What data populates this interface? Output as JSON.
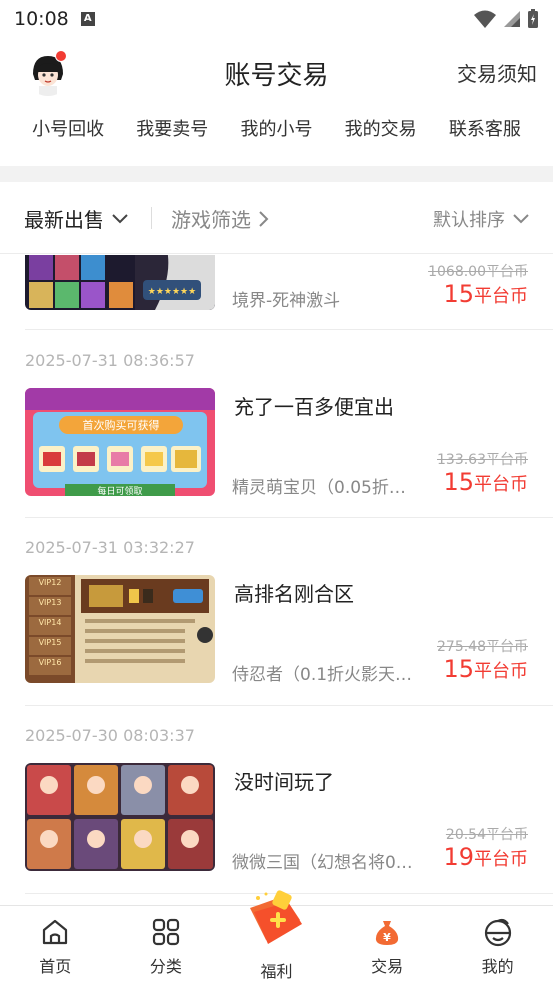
{
  "status": {
    "time": "10:08",
    "badge": "A"
  },
  "header": {
    "title": "账号交易",
    "notice": "交易须知"
  },
  "nav_links": [
    "小号回收",
    "我要卖号",
    "我的小号",
    "我的交易",
    "联系客服"
  ],
  "filters": {
    "latest": "最新出售",
    "game_filter": "游戏筛选",
    "sort": "默认排序"
  },
  "items": [
    {
      "date": "",
      "title": "",
      "game": "境界-死神激斗",
      "old_price": "1068.00平台币",
      "price": "15",
      "unit": "平台币",
      "thumb": "anime-roster"
    },
    {
      "date": "2025-07-31 08:36:57",
      "title": "充了一百多便宜出",
      "game": "精灵萌宝贝（0.05折…",
      "old_price": "133.63平台币",
      "price": "15",
      "unit": "平台币",
      "thumb": "first-recharge",
      "thumb_banner": "首次购买可获得",
      "thumb_footer": "每日可领取"
    },
    {
      "date": "2025-07-31 03:32:27",
      "title": "高排名刚合区",
      "game": "侍忍者（0.1折火影天…",
      "old_price": "275.48平台币",
      "price": "15",
      "unit": "平台币",
      "thumb": "vip-chest",
      "vip_levels": [
        "VIP12",
        "VIP13",
        "VIP14",
        "VIP15",
        "VIP16"
      ]
    },
    {
      "date": "2025-07-30 08:03:37",
      "title": "没时间玩了",
      "game": "微微三国（幻想名将0.…",
      "old_price": "20.54平台币",
      "price": "19",
      "unit": "平台币",
      "thumb": "hero-cards"
    }
  ],
  "tabs": [
    {
      "label": "首页",
      "icon": "home-icon"
    },
    {
      "label": "分类",
      "icon": "grid-icon"
    },
    {
      "label": "福利",
      "icon": "gift-icon"
    },
    {
      "label": "交易",
      "icon": "money-bag-icon"
    },
    {
      "label": "我的",
      "icon": "profile-icon"
    }
  ],
  "colors": {
    "accent": "#f23c33",
    "muted": "#888888",
    "tab_active": "#f26a33"
  }
}
